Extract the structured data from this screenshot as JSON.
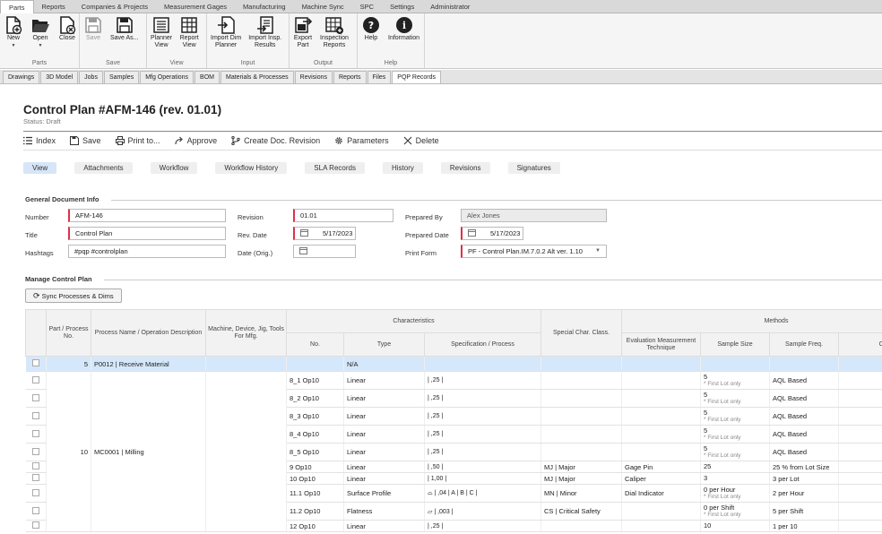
{
  "menu_tabs": [
    "Parts",
    "Reports",
    "Companies & Projects",
    "Measurement Gages",
    "Manufacturing",
    "Machine Sync",
    "SPC",
    "Settings",
    "Administrator"
  ],
  "ribbon": {
    "parts": {
      "label": "Parts",
      "new": "New",
      "open": "Open",
      "close": "Close"
    },
    "save": {
      "label": "Save",
      "save": "Save",
      "save_as": "Save As..."
    },
    "view": {
      "label": "View",
      "planner_view": "Planner",
      "planner_view2": "View",
      "report_view": "Report",
      "report_view2": "View"
    },
    "input": {
      "label": "Input",
      "import_dim": "Import Dim",
      "import_dim2": "Planner",
      "import_insp": "Import Insp.",
      "import_insp2": "Results"
    },
    "output": {
      "label": "Output",
      "export": "Export",
      "export2": "Part",
      "insp_reports": "Inspection",
      "insp_reports2": "Reports"
    },
    "help": {
      "label": "Help",
      "help": "Help",
      "information": "Information"
    }
  },
  "sub_tabs": [
    "Drawings",
    "3D Model",
    "Jobs",
    "Samples",
    "Mfg Operations",
    "BOM",
    "Materials & Processes",
    "Revisions",
    "Reports",
    "Files",
    "PQP Records"
  ],
  "page": {
    "title": "Control Plan #AFM-146 (rev. 01.01)",
    "status": "Status: Draft"
  },
  "toolbar": {
    "index": "Index",
    "save": "Save",
    "print": "Print to...",
    "approve": "Approve",
    "create_rev": "Create Doc. Revision",
    "parameters": "Parameters",
    "delete": "Delete"
  },
  "pills": [
    "View",
    "Attachments",
    "Workflow",
    "Workflow History",
    "SLA Records",
    "History",
    "Revisions",
    "Signatures"
  ],
  "general": {
    "title": "General Document Info",
    "number_label": "Number",
    "number": "AFM-146",
    "title_label": "Title",
    "title_value": "Control Plan",
    "hashtags_label": "Hashtags",
    "hashtags": "#pqp #controlplan",
    "revision_label": "Revision",
    "revision": "01.01",
    "rev_date_label": "Rev. Date",
    "rev_date": "5/17/2023",
    "date_orig_label": "Date (Orig.)",
    "prepared_by_label": "Prepared By",
    "prepared_by": "Alex Jones",
    "prepared_date_label": "Prepared Date",
    "prepared_date": "5/17/2023",
    "print_form_label": "Print Form",
    "print_form": "PF - Control Plan.IM.7.0.2 Alt ver. 1.10"
  },
  "manage": {
    "title": "Manage Control Plan",
    "sync_button": "Sync Processes & Dims"
  },
  "grid": {
    "headers": {
      "part_process": "Part / Process No.",
      "process_name": "Process Name / Operation Description",
      "machine": "Machine, Device, Jig, Tools For Mfg.",
      "characteristics": "Characteristics",
      "no": "No.",
      "type": "Type",
      "spec": "Specification / Process",
      "special": "Special Char. Class.",
      "methods": "Methods",
      "eval": "Evaluation Measurement Technique",
      "sample_size": "Sample Size",
      "sample_freq": "Sample Freq.",
      "control": "Con"
    },
    "group1": {
      "no": "5",
      "name": "P0012 | Receive Material",
      "type": "N/A"
    },
    "group2": {
      "no": "10",
      "name": "MC0001 | Milling"
    },
    "rows": [
      {
        "no": "8_1 Op10",
        "type": "Linear",
        "spec": "| ,25 |",
        "special": "",
        "eval": "",
        "size": "5",
        "note": "* First Lot only",
        "freq": "AQL Based"
      },
      {
        "no": "8_2 Op10",
        "type": "Linear",
        "spec": "| ,25 |",
        "special": "",
        "eval": "",
        "size": "5",
        "note": "* First Lot only",
        "freq": "AQL Based"
      },
      {
        "no": "8_3 Op10",
        "type": "Linear",
        "spec": "| ,25 |",
        "special": "",
        "eval": "",
        "size": "5",
        "note": "* First Lot only",
        "freq": "AQL Based"
      },
      {
        "no": "8_4 Op10",
        "type": "Linear",
        "spec": "| ,25 |",
        "special": "",
        "eval": "",
        "size": "5",
        "note": "* First Lot only",
        "freq": "AQL Based"
      },
      {
        "no": "8_5 Op10",
        "type": "Linear",
        "spec": "| ,25 |",
        "special": "",
        "eval": "",
        "size": "5",
        "note": "* First Lot only",
        "freq": "AQL Based"
      },
      {
        "no": "9 Op10",
        "type": "Linear",
        "spec": "| ,50 |",
        "special": "MJ | Major",
        "eval": "Gage Pin",
        "size": "25",
        "note": "",
        "freq": "25 % from Lot Size"
      },
      {
        "no": "10 Op10",
        "type": "Linear",
        "spec": "| 1,00 |",
        "special": "MJ | Major",
        "eval": "Caliper",
        "size": "3",
        "note": "",
        "freq": "3 per Lot"
      },
      {
        "no": "11.1 Op10",
        "type": "Surface Profile",
        "spec": "⌓ | ,04 | A | B | C |",
        "special": "MN | Minor",
        "eval": "Dial Indicator",
        "size": "0 per Hour",
        "note": "* First Lot only",
        "freq": "2 per Hour"
      },
      {
        "no": "11.2 Op10",
        "type": "Flatness",
        "spec": "▱ | ,003 |",
        "special": "CS | Critical Safety",
        "eval": "",
        "size": "0 per Shift",
        "note": "* First Lot only",
        "freq": "5 per Shift"
      },
      {
        "no": "12 Op10",
        "type": "Linear",
        "spec": "| ,25 |",
        "special": "",
        "eval": "",
        "size": "10",
        "note": "",
        "freq": "1 per 10"
      }
    ]
  }
}
